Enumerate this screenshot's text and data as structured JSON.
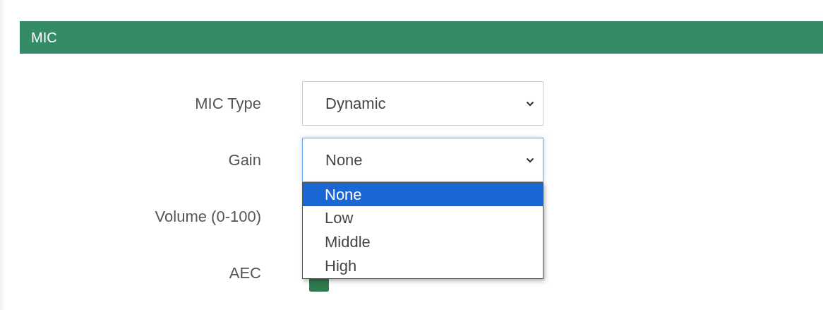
{
  "section": {
    "title": "MIC"
  },
  "fields": [
    {
      "kind": "select",
      "label": "MIC Type",
      "value": "Dynamic",
      "expanded": false
    },
    {
      "kind": "select",
      "label": "Gain",
      "value": "None",
      "expanded": true,
      "options": [
        {
          "label": "None",
          "selected": true
        },
        {
          "label": "Low",
          "selected": false
        },
        {
          "label": "Middle",
          "selected": false
        },
        {
          "label": "High",
          "selected": false
        }
      ]
    },
    {
      "kind": "number",
      "label": "Volume (0-100)"
    },
    {
      "kind": "checkbox",
      "label": "AEC",
      "checked": true
    }
  ]
}
